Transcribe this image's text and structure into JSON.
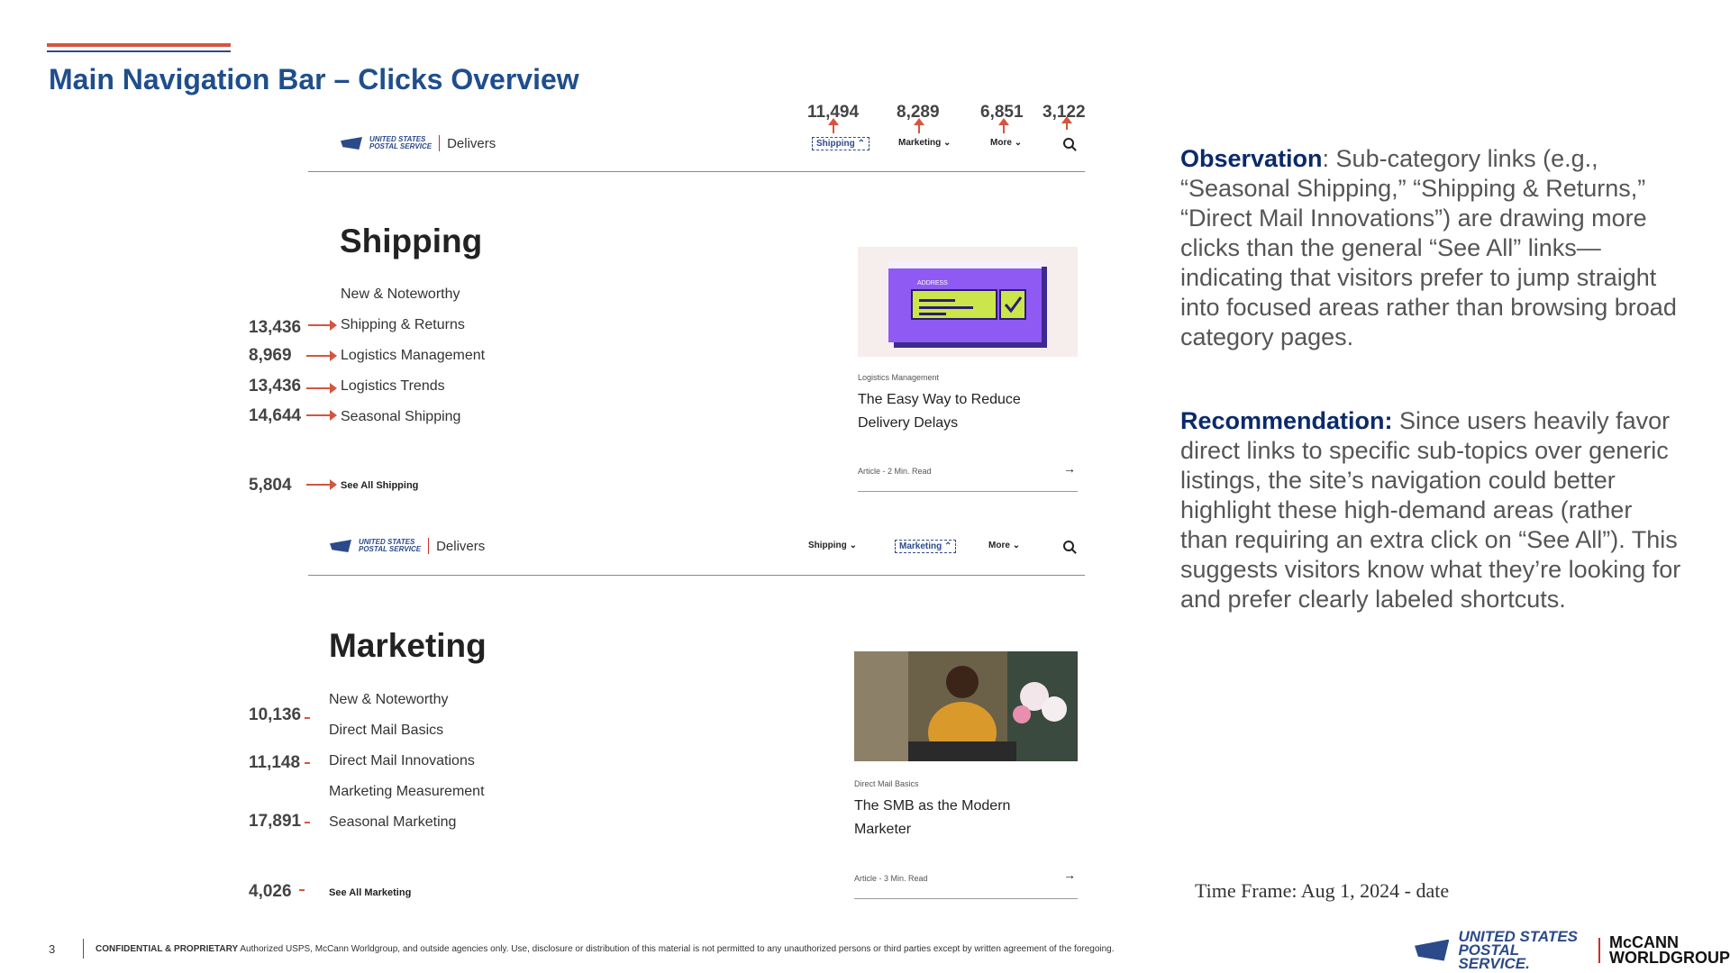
{
  "slide": {
    "title": "Main Navigation Bar – Clicks Overview",
    "page_number": "3"
  },
  "nav_clicks": {
    "shipping": "11,494",
    "marketing": "8,289",
    "more": "6,851",
    "search": "3,122"
  },
  "site_header": {
    "logo_line1": "UNITED STATES",
    "logo_line2": "POSTAL SERVICE",
    "delivers": "Delivers",
    "nav_shipping": "Shipping",
    "nav_marketing": "Marketing",
    "nav_more": "More"
  },
  "shipping_menu": {
    "heading": "Shipping",
    "links": [
      {
        "label": "New & Noteworthy",
        "clicks": ""
      },
      {
        "label": "Shipping & Returns",
        "clicks": "13,436"
      },
      {
        "label": "Logistics Management",
        "clicks": "8,969"
      },
      {
        "label": "Logistics Trends",
        "clicks": "13,436"
      },
      {
        "label": "Seasonal Shipping",
        "clicks": "14,644"
      }
    ],
    "see_all": {
      "label": "See All Shipping",
      "clicks": "5,804"
    },
    "card": {
      "image_label": "ADDRESS",
      "category": "Logistics Management",
      "title": "The Easy Way to Reduce Delivery Delays",
      "meta": "Article - 2 Min. Read",
      "arrow": "→"
    }
  },
  "marketing_menu": {
    "heading": "Marketing",
    "links": [
      {
        "label": "New & Noteworthy",
        "clicks": ""
      },
      {
        "label": "Direct Mail Basics",
        "clicks": "10,136"
      },
      {
        "label": "Direct Mail Innovations",
        "clicks": "11,148"
      },
      {
        "label": "Marketing Measurement",
        "clicks": ""
      },
      {
        "label": "Seasonal Marketing",
        "clicks": "17,891"
      }
    ],
    "see_all": {
      "label": "See All Marketing",
      "clicks": "4,026"
    },
    "card": {
      "category": "Direct Mail Basics",
      "title": "The SMB as the Modern Marketer",
      "meta": "Article - 3 Min. Read",
      "arrow": "→"
    }
  },
  "observation": {
    "label": "Observation",
    "text": ": Sub-category links (e.g., “Seasonal Shipping,” “Shipping & Returns,” “Direct Mail Innovations”) are drawing more clicks than the general “See All” links—indicating that visitors prefer to jump straight into focused areas rather than browsing broad category pages."
  },
  "recommendation": {
    "label": "Recommendation:",
    "text": " Since users heavily favor direct links to specific sub-topics over generic listings, the site’s navigation could better highlight these high-demand areas (rather than requiring an extra click on “See All”). This suggests visitors know what they’re looking for and prefer clearly labeled shortcuts."
  },
  "time_frame": "Time Frame: Aug 1, 2024 - date",
  "footer": {
    "confidential": "CONFIDENTIAL & PROPRIETARY",
    "text": " Authorized USPS, McCann Worldgroup, and outside agencies only. Use, disclosure or distribution of this material is not permitted to any unauthorized persons or third parties except by written agreement of the foregoing."
  },
  "footer_logo": {
    "usps1": "UNITED STATES",
    "usps2": "POSTAL SERVICE.",
    "mccann1": "McCANN",
    "mccann2": "WORLDGROUP"
  },
  "colors": {
    "title_blue": "#1f4e8c",
    "accent_red": "#d5553f",
    "label_navy": "#0b2a6a"
  }
}
